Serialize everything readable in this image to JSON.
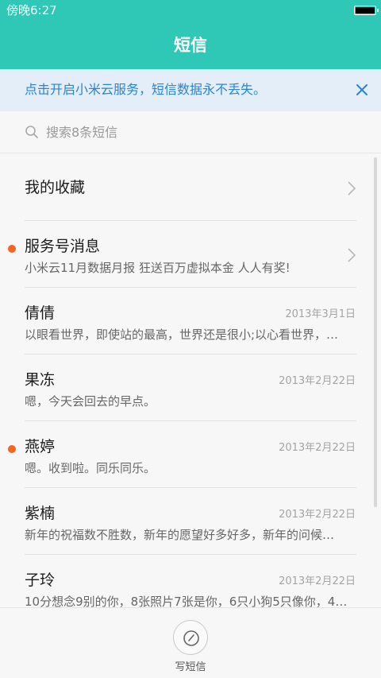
{
  "status_bar": {
    "time": "傍晚6:27"
  },
  "header": {
    "title": "短信"
  },
  "notice": {
    "text": "点击开启小米云服务，短信数据永不丢失。"
  },
  "search": {
    "placeholder": "搜索8条短信"
  },
  "conversations": [
    {
      "name": "我的收藏",
      "date": "",
      "preview": "",
      "unread": false,
      "chevron": true
    },
    {
      "name": "服务号消息",
      "date": "",
      "preview": "小米云11月数据月报 狂送百万虚拟本金 人人有奖!",
      "unread": true,
      "chevron": true
    },
    {
      "name": "倩倩",
      "date": "2013年3月1日",
      "preview": "以眼看世界，即使站的最高，世界还是很小;以心看世界，…",
      "unread": false,
      "chevron": false
    },
    {
      "name": "果冻",
      "date": "2013年2月22日",
      "preview": "嗯，今天会回去的早点。",
      "unread": false,
      "chevron": false
    },
    {
      "name": "燕婷",
      "date": "2013年2月22日",
      "preview": "嗯。收到啦。同乐同乐。",
      "unread": true,
      "chevron": false
    },
    {
      "name": "紫楠",
      "date": "2013年2月22日",
      "preview": "新年的祝福数不胜数，新年的愿望好多好多，新年的问候…",
      "unread": false,
      "chevron": false
    },
    {
      "name": "子玲",
      "date": "2013年2月22日",
      "preview": "10分想念9别的你，8张照片7张是你，6只小狗5只像你，4…",
      "unread": false,
      "chevron": false
    }
  ],
  "bottom": {
    "compose_label": "写短信"
  },
  "colors": {
    "accent": "#2fc7b5",
    "notice_text": "#2a84d6",
    "unread_dot": "#f4661e"
  }
}
